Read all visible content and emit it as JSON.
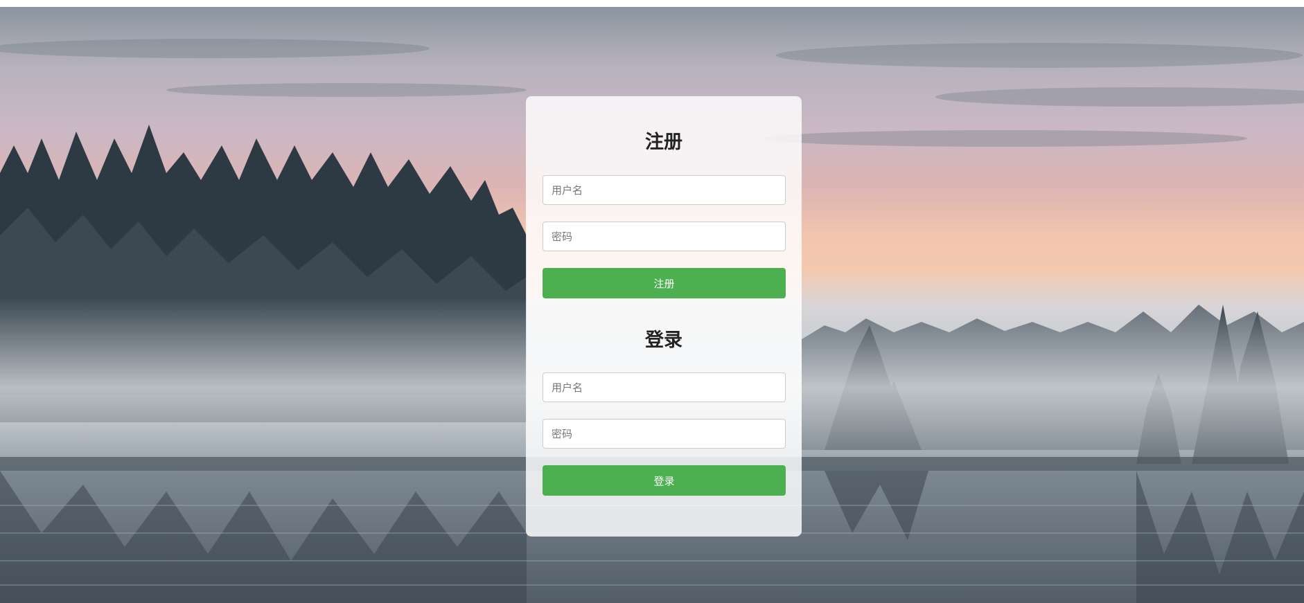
{
  "register": {
    "title": "注册",
    "username_placeholder": "用户名",
    "password_placeholder": "密码",
    "button_label": "注册"
  },
  "login": {
    "title": "登录",
    "username_placeholder": "用户名",
    "password_placeholder": "密码",
    "button_label": "登录"
  },
  "colors": {
    "button": "#4caf50",
    "card": "rgba(255,255,255,0.82)"
  }
}
